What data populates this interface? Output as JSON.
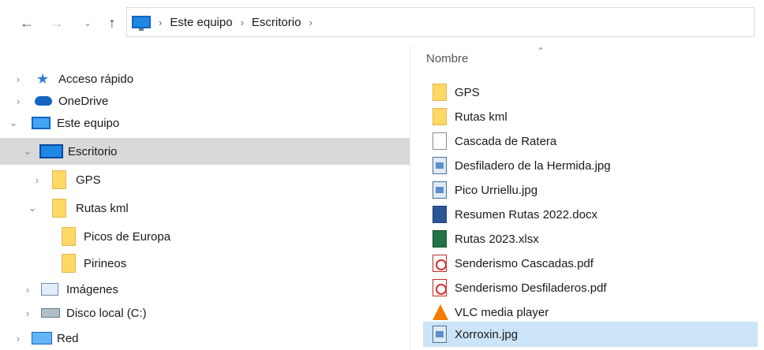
{
  "toolbar": {
    "back_icon": "arrow-left-icon",
    "forward_icon": "arrow-right-icon",
    "recent_icon": "chevron-down-icon",
    "up_icon": "arrow-up-icon",
    "back_glyph": "←",
    "forward_glyph": "→",
    "recent_glyph": "⌄",
    "up_glyph": "↑"
  },
  "address": {
    "breadcrumbs": [
      "Este equipo",
      "Escritorio"
    ],
    "separator": "›"
  },
  "nav_tree": {
    "items": [
      {
        "label": "Acceso rápido",
        "icon": "star-icon"
      },
      {
        "label": "OneDrive",
        "icon": "cloud-icon"
      },
      {
        "label": "Este equipo",
        "icon": "computer-icon"
      },
      {
        "label": "Escritorio",
        "icon": "desktop-icon"
      },
      {
        "label": "GPS",
        "icon": "folder-icon"
      },
      {
        "label": "Rutas kml",
        "icon": "folder-icon"
      },
      {
        "label": "Picos de Europa",
        "icon": "folder-icon"
      },
      {
        "label": "Pirineos",
        "icon": "folder-icon"
      },
      {
        "label": "Imágenes",
        "icon": "pictures-icon"
      },
      {
        "label": "Disco local (C:)",
        "icon": "disk-icon"
      },
      {
        "label": "Red",
        "icon": "network-icon"
      }
    ],
    "chevron_collapsed": "›",
    "chevron_expanded": "⌄",
    "selected": "Escritorio"
  },
  "file_list": {
    "column_header": "Nombre",
    "sort_glyph": "⌃",
    "files": [
      {
        "name": "GPS",
        "type": "folder"
      },
      {
        "name": "Rutas kml",
        "type": "folder"
      },
      {
        "name": "Cascada de Ratera",
        "type": "file"
      },
      {
        "name": "Desfiladero de la Hermida.jpg",
        "type": "jpg"
      },
      {
        "name": "Pico Urriellu.jpg",
        "type": "jpg"
      },
      {
        "name": "Resumen Rutas 2022.docx",
        "type": "docx"
      },
      {
        "name": "Rutas 2023.xlsx",
        "type": "xlsx"
      },
      {
        "name": "Senderismo Cascadas.pdf",
        "type": "pdf"
      },
      {
        "name": "Senderismo Desfiladeros.pdf",
        "type": "pdf"
      },
      {
        "name": "VLC media player",
        "type": "shortcut"
      },
      {
        "name": "Xorroxin.jpg",
        "type": "jpg"
      }
    ],
    "selected": "Xorroxin.jpg"
  },
  "colors": {
    "tree_selected": "#d9d9d9",
    "file_selected": "#cce4f7",
    "folder": "#ffd866",
    "accent": "#1e88e5"
  }
}
